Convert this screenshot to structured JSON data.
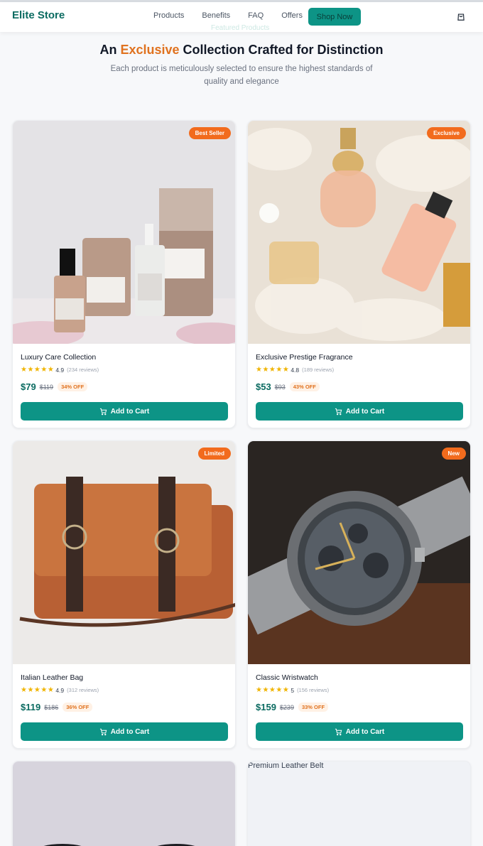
{
  "header": {
    "brand": "Elite Store",
    "nav": [
      "Products",
      "Benefits",
      "FAQ",
      "Offers"
    ],
    "cta": "Shop Now",
    "ghost_text": "Featured Products"
  },
  "hero": {
    "title_prefix": "An ",
    "title_accent": "Exclusive",
    "title_suffix": " Collection Crafted for Distinction",
    "subtitle": "Each product is meticulously selected to ensure the highest standards of quality and elegance"
  },
  "products": [
    {
      "name": "Luxury Care Collection",
      "badge": "Best Seller",
      "stars": "★★★★★",
      "rating": "4.9",
      "reviews": "(234 reviews)",
      "price": "$79",
      "old_price": "$119",
      "discount": "34% OFF",
      "cta": "Add to Cart"
    },
    {
      "name": "Exclusive Prestige Fragrance",
      "badge": "Exclusive",
      "stars": "★★★★★",
      "rating": "4.8",
      "reviews": "(189 reviews)",
      "price": "$53",
      "old_price": "$93",
      "discount": "43% OFF",
      "cta": "Add to Cart"
    },
    {
      "name": "Italian Leather Bag",
      "badge": "Limited",
      "stars": "★★★★★",
      "rating": "4.9",
      "reviews": "(312 reviews)",
      "price": "$119",
      "old_price": "$186",
      "discount": "36% OFF",
      "cta": "Add to Cart"
    },
    {
      "name": "Classic Wristwatch",
      "badge": "New",
      "stars": "★★★★★",
      "rating": "5",
      "reviews": "(156 reviews)",
      "price": "$159",
      "old_price": "$239",
      "discount": "33% OFF",
      "cta": "Add to Cart"
    }
  ],
  "partial_cards": [
    {
      "alt": ""
    },
    {
      "alt": "Premium Leather Belt"
    }
  ],
  "colors": {
    "accent": "#e0721f",
    "brand": "#0b6b61",
    "button": "#0d9486",
    "badge": "#f26b1d",
    "star": "#f0b400"
  },
  "icons": {
    "cart": "shopping-bag-icon",
    "add": "cart-icon",
    "star": "star-icon"
  }
}
